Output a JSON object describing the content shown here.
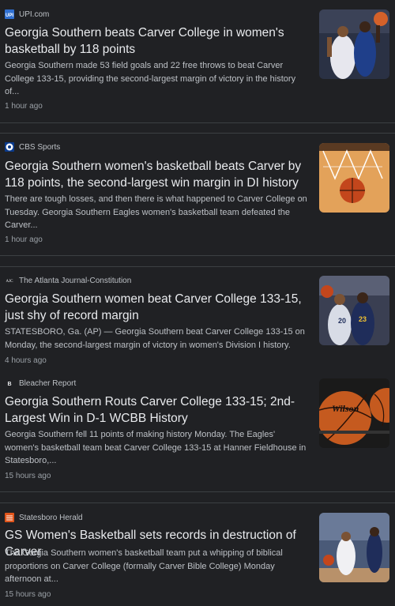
{
  "articles": [
    {
      "source": "UPI.com",
      "logo": "upi-logo",
      "headline": "Georgia Southern beats Carver College in women's basketball by 118 points",
      "snippet": "Georgia Southern made 53 field goals and 22 free throws to beat Carver College 133-15, providing the second-largest margin of victory in the history of...",
      "time": "1 hour ago",
      "thumbnail": "basketball-players-photo"
    },
    {
      "source": "CBS Sports",
      "logo": "cbs-sports-logo",
      "headline": "Georgia Southern women's basketball beats Carver by 118 points, the second-largest win margin in DI history",
      "snippet": "There are tough losses, and then there is what happened to Carver College on Tuesday. Georgia Southern Eagles women's basketball team defeated the Carver...",
      "time": "1 hour ago",
      "thumbnail": "basketball-net-photo"
    },
    {
      "source": "The Atlanta Journal-Constitution",
      "logo": "ajc-logo",
      "headline": "Georgia Southern women beat Carver College 133-15, just shy of record margin",
      "snippet": "STATESBORO, Ga. (AP) — Georgia Southern beat Carver College 133-15 on Monday, the second-largest margin of victory in women's Division I history.",
      "time": "4 hours ago",
      "thumbnail": "basketball-players-photo"
    },
    {
      "source": "Bleacher Report",
      "logo": "bleacher-report-logo",
      "headline": "Georgia Southern Routs Carver College 133-15; 2nd-Largest Win in D-1 WCBB History",
      "snippet": "Georgia Southern fell 11 points of making history Monday. The Eagles' women's basketball team beat Carver College 133-15 at Hanner Fieldhouse in Statesboro,...",
      "time": "15 hours ago",
      "thumbnail": "wilson-basketballs-photo"
    },
    {
      "source": "Statesboro Herald",
      "logo": "statesboro-herald-logo",
      "headline": "GS Women's Basketball sets records in destruction of Carver",
      "snippet": "The Gorgia Southern women's basketball team put a whipping of biblical proportions on Carver College (formally Carver Bible College) Monday afternoon at...",
      "time": "15 hours ago",
      "thumbnail": "basketball-game-photo"
    }
  ]
}
